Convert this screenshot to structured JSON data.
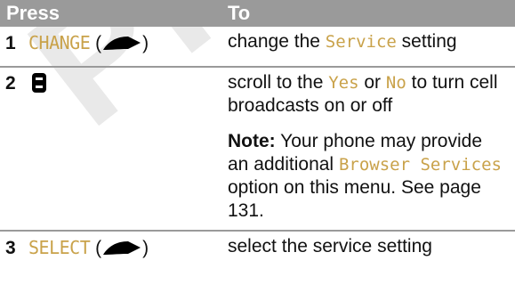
{
  "watermark": "PRELIMINARY",
  "table": {
    "header": {
      "press": "Press",
      "to": "To"
    },
    "rows": [
      {
        "step": "1",
        "key": "CHANGE",
        "paren_open": "(",
        "paren_close": ")",
        "desc_before": "change the ",
        "desc_display": "Service",
        "desc_after": " setting"
      },
      {
        "step": "2",
        "desc_before": "scroll to the ",
        "desc_display1": "Yes",
        "desc_mid1": " or ",
        "desc_display2": "No",
        "desc_after": " to turn cell broadcasts on or off",
        "note_label": "Note:",
        "note_text": " Your phone may provide an additional ",
        "note_display": "Browser Services",
        "note_after": " option on this menu. See page 131."
      },
      {
        "step": "3",
        "key": "SELECT",
        "paren_open": "(",
        "paren_close": ")",
        "desc": "select the service setting"
      }
    ]
  },
  "colors": {
    "header_bg": "#9a9a9a",
    "display_text": "#c9a24a",
    "watermark": "#d8d8d8"
  },
  "icons": [
    "soft-key-icon",
    "nav-key-icon"
  ]
}
